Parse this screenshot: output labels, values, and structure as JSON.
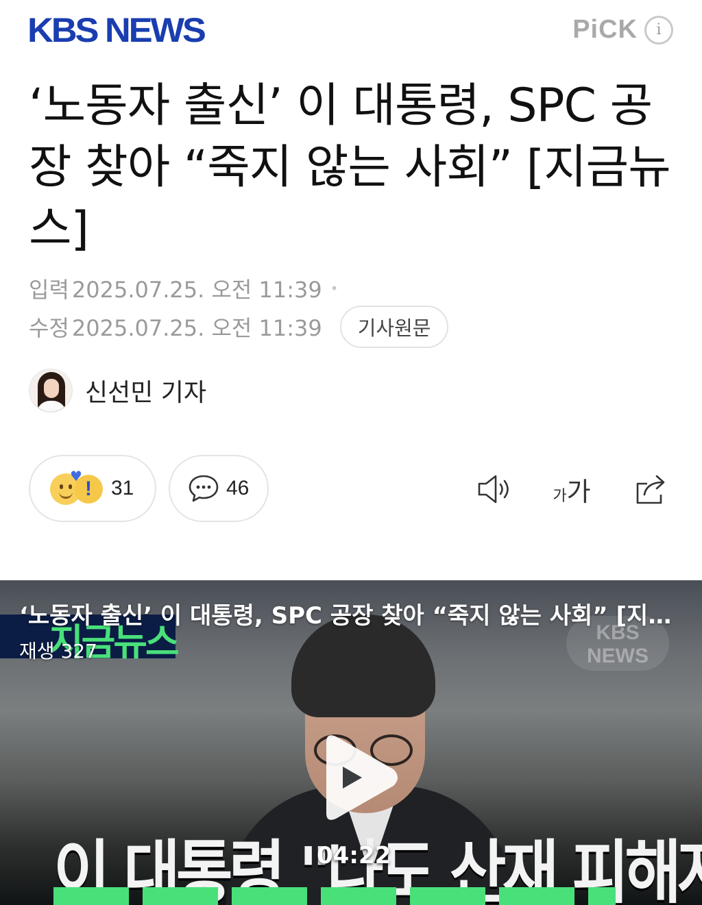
{
  "header": {
    "logo_text": "KBS NEWS",
    "pick_label": "PiCK",
    "info_icon": "info-icon"
  },
  "article": {
    "title": "‘노동자 출신’ 이 대통령, SPC 공장 찾아 “죽지 않는 사회” [지금뉴스]",
    "published_label": "입력",
    "published_value": "2025.07.25. 오전 11:39",
    "modified_label": "수정",
    "modified_value": "2025.07.25. 오전 11:39",
    "source_button": "기사원문",
    "reporter": "신선민 기자"
  },
  "actions": {
    "reaction_count": "31",
    "comment_count": "46",
    "font_small": "가",
    "font_big": "가"
  },
  "video": {
    "title": "‘노동자 출신’ 이 대통령, SPC 공장 찾아 “죽지 않는 사회” [지금뉴스]",
    "views_label": "재생",
    "views_count": "327",
    "badge_text": "지금뉴스",
    "watermark": "KBS NEWS",
    "caption": "이 대통령 \"나도 산재 피해자··",
    "duration": "04:22"
  },
  "colors": {
    "brand": "#1a3db0",
    "meta_text": "#9a9a9a",
    "badge_green": "#49e07a"
  }
}
